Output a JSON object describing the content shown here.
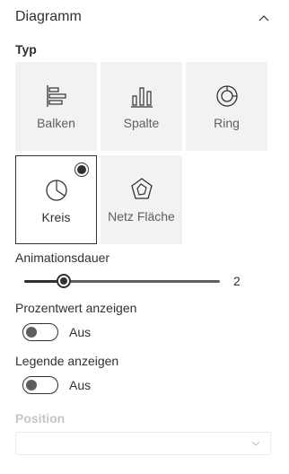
{
  "header": {
    "title": "Diagramm"
  },
  "type_section": {
    "label": "Typ",
    "tiles": [
      {
        "label": "Balken",
        "icon": "bar-chart-icon",
        "selected": false
      },
      {
        "label": "Spalte",
        "icon": "column-chart-icon",
        "selected": false
      },
      {
        "label": "Ring",
        "icon": "donut-chart-icon",
        "selected": false
      },
      {
        "label": "Kreis",
        "icon": "pie-chart-icon",
        "selected": true
      },
      {
        "label": "Netz Fläche",
        "icon": "radar-chart-icon",
        "selected": false
      }
    ]
  },
  "animation": {
    "label": "Animationsdauer",
    "value": "2",
    "fraction": 0.2
  },
  "percent_toggle": {
    "label": "Prozentwert anzeigen",
    "state_text": "Aus",
    "on": false
  },
  "legend_toggle": {
    "label": "Legende anzeigen",
    "state_text": "Aus",
    "on": false
  },
  "position": {
    "label": "Position",
    "value": "",
    "disabled": true
  },
  "colors": {
    "text": "#323130",
    "tile_bg": "#f3f2f1",
    "muted": "#605e5c",
    "disabled": "#c8c6c4"
  }
}
